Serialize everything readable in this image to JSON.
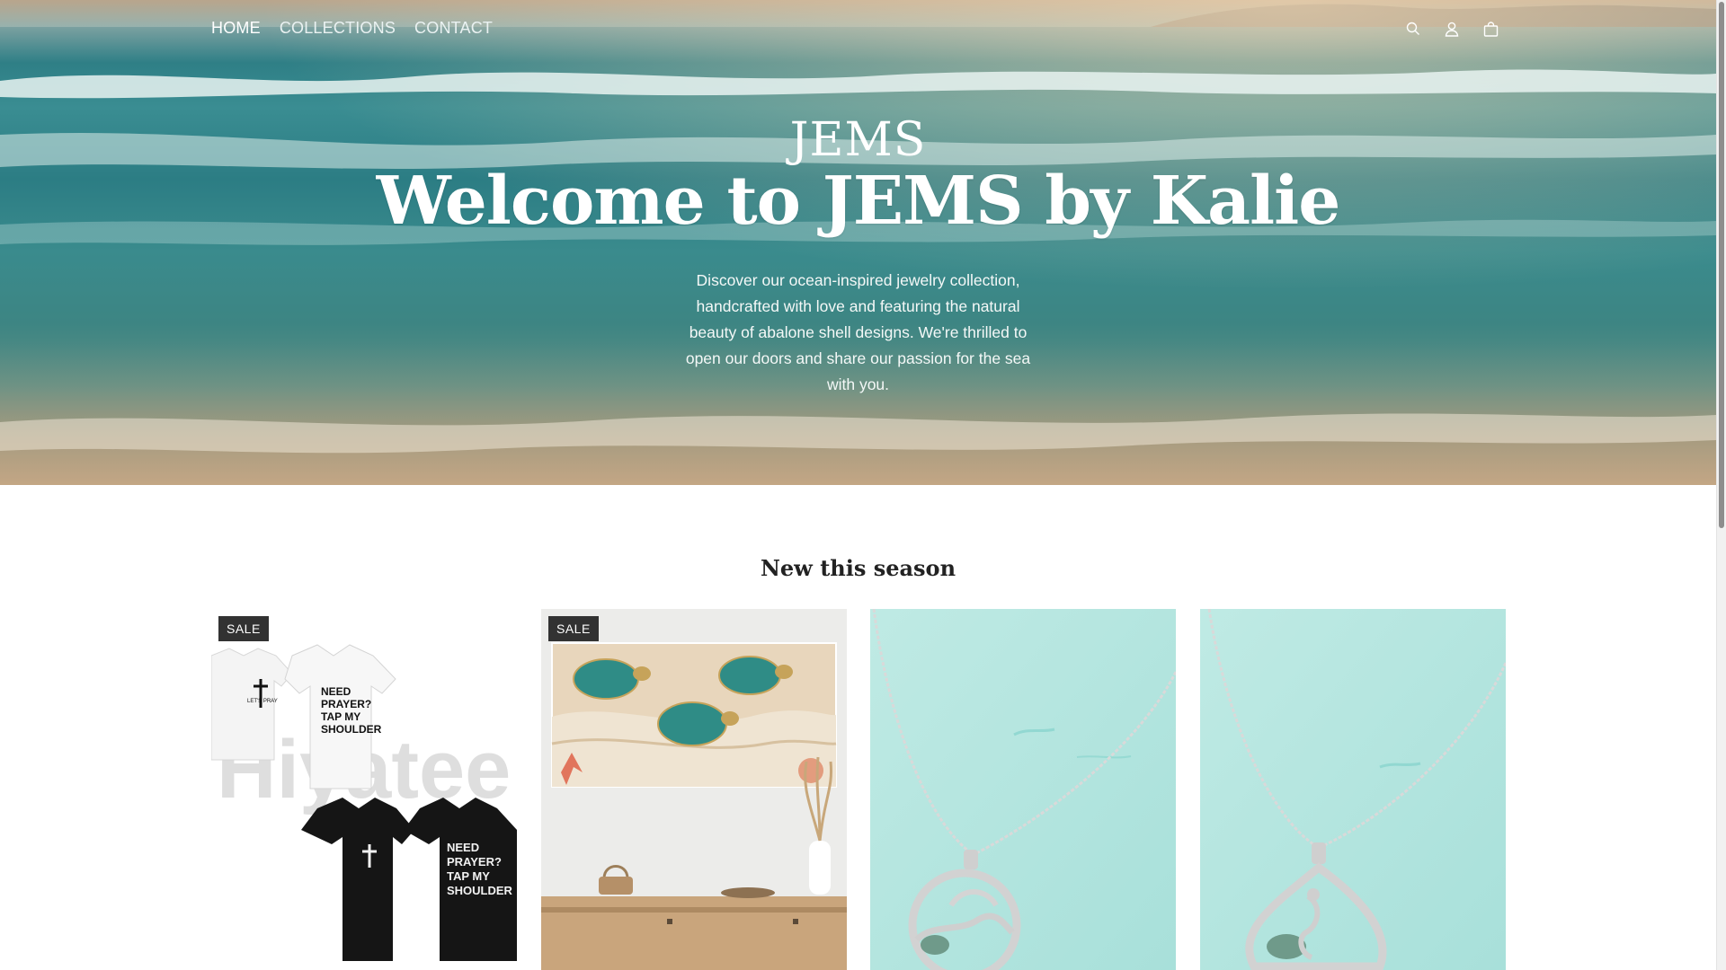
{
  "nav": {
    "items": [
      {
        "label": "HOME",
        "active": true
      },
      {
        "label": "COLLECTIONS",
        "active": false
      },
      {
        "label": "CONTACT",
        "active": false
      }
    ]
  },
  "header_icons": [
    "search-icon",
    "account-icon",
    "cart-icon"
  ],
  "hero": {
    "brand": "JEMS",
    "headline": "Welcome to JEMS by Kalie",
    "description": "Discover our ocean-inspired jewelry collection, handcrafted with love and featuring the natural beauty of abalone shell designs. We're thrilled to open our doors and share our passion for the sea with you."
  },
  "section": {
    "title": "New this season"
  },
  "products": [
    {
      "badge": "SALE",
      "image": "christian-tshirts-white-and-black",
      "print_text": "NEED PRAYER? TAP MY SHOULDER",
      "small_text": "LET'S PRAY",
      "watermark": "Hiyatee"
    },
    {
      "badge": "SALE",
      "image": "sea-turtle-canvas-art-over-console-table"
    },
    {
      "badge": "",
      "image": "abalone-dolphin-pendant-necklace"
    },
    {
      "badge": "",
      "image": "abalone-seahorse-pendant-necklace"
    }
  ],
  "colors": {
    "header_text": "#ffffff",
    "title_text": "#222222",
    "badge_bg": "#323232",
    "necklace_bg": "#bfe9e4"
  }
}
